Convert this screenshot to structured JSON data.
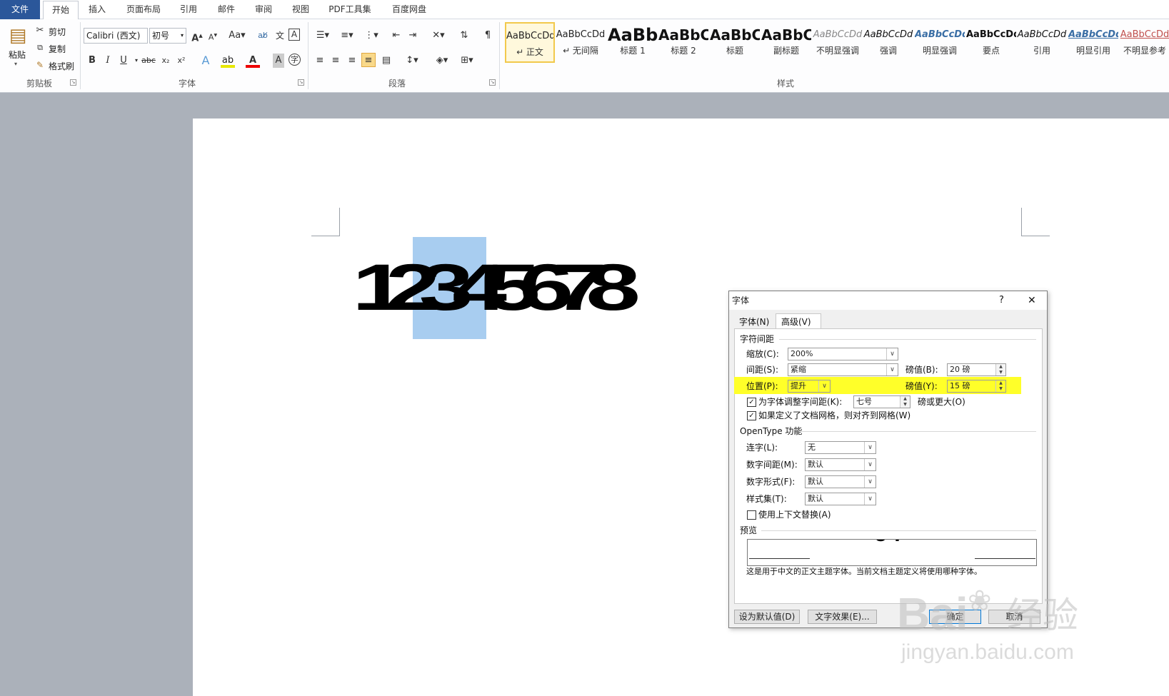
{
  "tabs": {
    "file": "文件",
    "home": "开始",
    "insert": "插入",
    "page_layout": "页面布局",
    "references": "引用",
    "mailings": "邮件",
    "review": "审阅",
    "view": "视图",
    "pdf_tools": "PDF工具集",
    "baidu_disk": "百度网盘"
  },
  "clipboard": {
    "paste": "粘贴",
    "cut": "剪切",
    "copy": "复制",
    "format_painter": "格式刷",
    "group_label": "剪贴板"
  },
  "font": {
    "name": "Calibri (西文)",
    "size": "初号",
    "group_label": "字体"
  },
  "paragraph": {
    "group_label": "段落"
  },
  "styles": {
    "group_label": "样式",
    "items": [
      {
        "preview": "AaBbCcDd",
        "name": "↵ 正文"
      },
      {
        "preview": "AaBbCcDd",
        "name": "↵ 无间隔"
      },
      {
        "preview": "AaBb",
        "name": "标题 1"
      },
      {
        "preview": "AaBbC",
        "name": "标题 2"
      },
      {
        "preview": "AaBbC",
        "name": "标题"
      },
      {
        "preview": "AaBbC",
        "name": "副标题"
      },
      {
        "preview": "AaBbCcDd",
        "name": "不明显强调"
      },
      {
        "preview": "AaBbCcDd",
        "name": "强调"
      },
      {
        "preview": "AaBbCcDd",
        "name": "明显强调"
      },
      {
        "preview": "AaBbCcDd",
        "name": "要点"
      },
      {
        "preview": "AaBbCcDd",
        "name": "引用"
      },
      {
        "preview": "AaBbCcDd",
        "name": "明显引用"
      },
      {
        "preview": "AaBbCcDd",
        "name": "不明显参考"
      }
    ]
  },
  "document": {
    "text": "12345678"
  },
  "dialog": {
    "title": "字体",
    "help": "?",
    "close": "✕",
    "tab_font": "字体(N)",
    "tab_advanced": "高级(V)",
    "section_spacing": "字符间距",
    "scale_label": "缩放(C):",
    "scale_value": "200%",
    "spacing_label": "间距(S):",
    "spacing_value": "紧缩",
    "spacing_by_label": "磅值(B):",
    "spacing_by_value": "20 磅",
    "position_label": "位置(P):",
    "position_value": "提升",
    "position_by_label": "磅值(Y):",
    "position_by_value": "15 磅",
    "kerning_label": "为字体调整字间距(K):",
    "kerning_value": "七号",
    "kerning_suffix": "磅或更大(O)",
    "grid_label": "如果定义了文档网格，则对齐到网格(W)",
    "section_opentype": "OpenType 功能",
    "ligatures_label": "连字(L):",
    "ligatures_value": "无",
    "num_spacing_label": "数字间距(M):",
    "num_spacing_value": "默认",
    "num_forms_label": "数字形式(F):",
    "num_forms_value": "默认",
    "stylistic_label": "样式集(T):",
    "stylistic_value": "默认",
    "contextual_label": "使用上下文替换(A)",
    "preview_label": "预览",
    "preview_desc": "这是用于中文的正文主题字体。当前文档主题定义将使用哪种字体。",
    "btn_default": "设为默认值(D)",
    "btn_effects": "文字效果(E)...",
    "btn_ok": "确定",
    "btn_cancel": "取消"
  },
  "watermark": {
    "brand": "Bai",
    "brand2": "经验",
    "url": "jingyan.baidu.com"
  }
}
